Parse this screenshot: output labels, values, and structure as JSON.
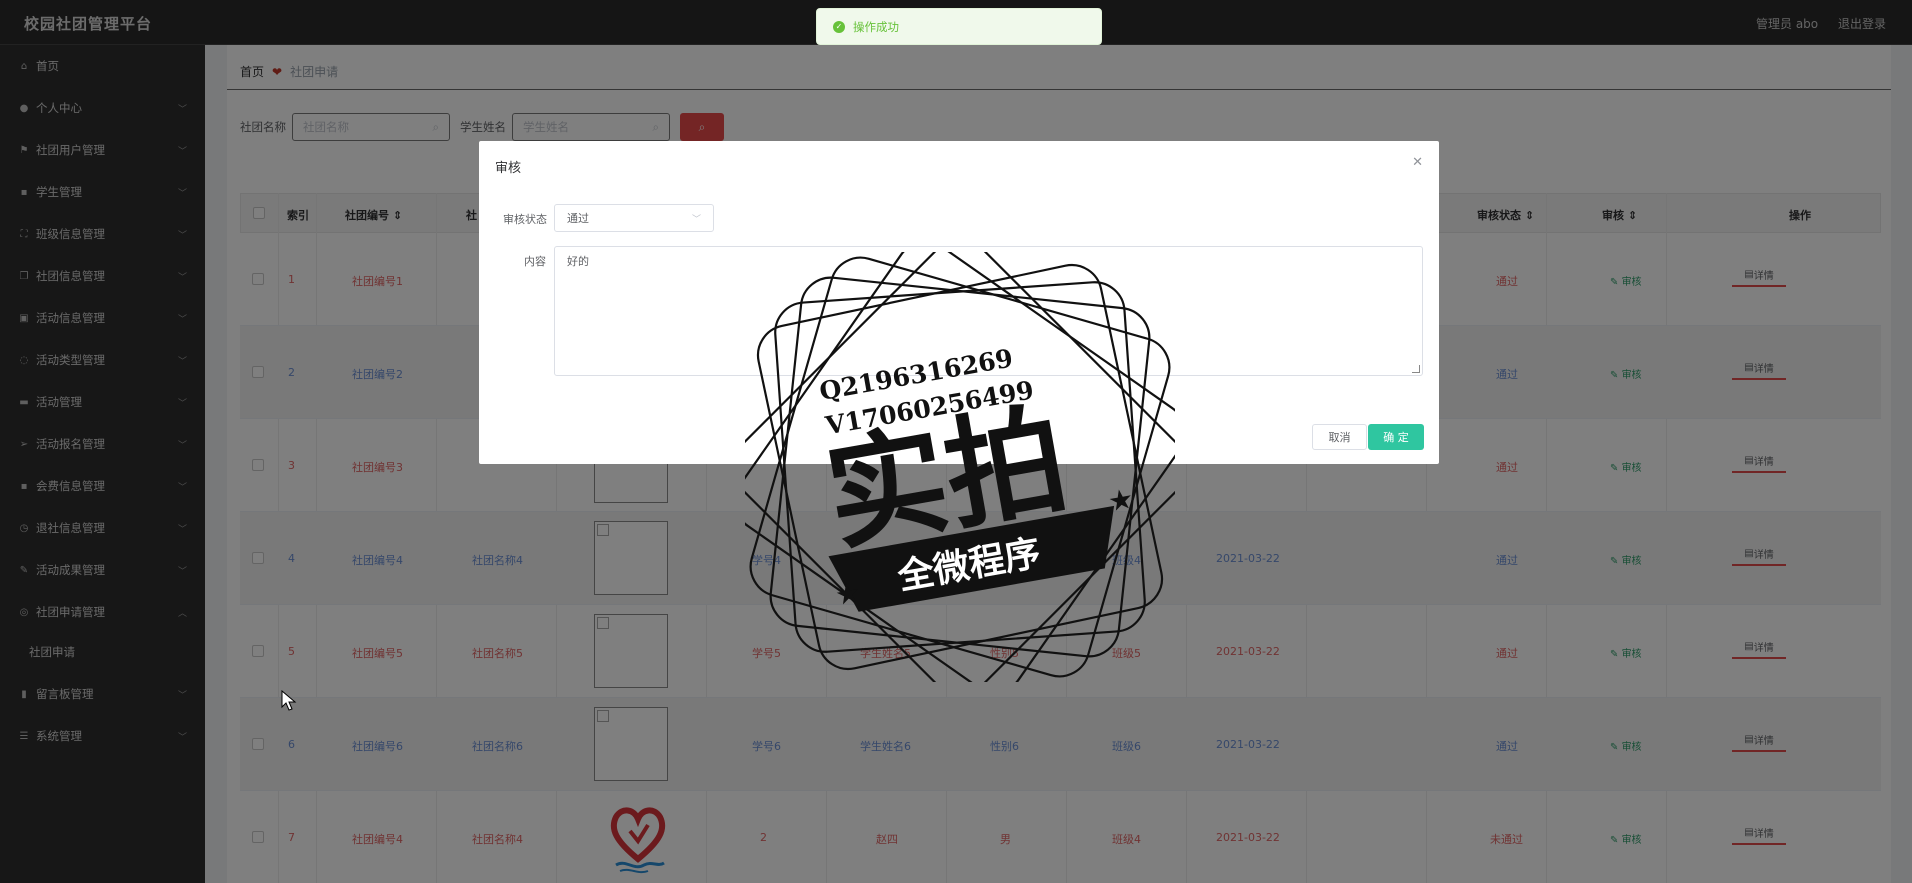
{
  "header": {
    "title": "校园社团管理平台",
    "user": "管理员 abo",
    "logout": "退出登录"
  },
  "sidebar": {
    "items": [
      {
        "label": "首页",
        "icon": "home-icon"
      },
      {
        "label": "个人中心",
        "icon": "user-icon"
      },
      {
        "label": "社团用户管理",
        "icon": "flag-icon"
      },
      {
        "label": "学生管理",
        "icon": "chat-icon"
      },
      {
        "label": "班级信息管理",
        "icon": "frame-icon"
      },
      {
        "label": "社团信息管理",
        "icon": "copy-icon"
      },
      {
        "label": "活动信息管理",
        "icon": "clipboard-icon"
      },
      {
        "label": "活动类型管理",
        "icon": "dashed-circle-icon"
      },
      {
        "label": "活动管理",
        "icon": "suitcase-icon"
      },
      {
        "label": "活动报名管理",
        "icon": "send-icon"
      },
      {
        "label": "会费信息管理",
        "icon": "chat-icon"
      },
      {
        "label": "退社信息管理",
        "icon": "clock-icon"
      },
      {
        "label": "活动成果管理",
        "icon": "edit-icon"
      },
      {
        "label": "社团申请管理",
        "icon": "circle-icon"
      },
      {
        "label": "留言板管理",
        "icon": "chart-icon"
      },
      {
        "label": "系统管理",
        "icon": "list-icon"
      }
    ],
    "submenu": "社团申请"
  },
  "breadcrumb": {
    "home": "首页",
    "current": "社团申请"
  },
  "search": {
    "club_label": "社团名称",
    "club_placeholder": "社团名称",
    "student_label": "学生姓名",
    "student_placeholder": "学生姓名"
  },
  "table": {
    "headers": {
      "index": "索引",
      "club_no": "社团编号",
      "club_name": "社",
      "audit_status": "审核状态",
      "audit": "审核",
      "ops": "操作"
    },
    "rows": [
      {
        "idx": "1",
        "no": "社团编号1",
        "color": "#e06666",
        "status": "通过"
      },
      {
        "idx": "2",
        "no": "社团编号2",
        "color": "#6b8fd4",
        "status": "通过"
      },
      {
        "idx": "3",
        "no": "社团编号3",
        "color": "#e06666",
        "status": "通过"
      },
      {
        "idx": "4",
        "no": "社团编号4",
        "name": "社团名称4",
        "sno": "学号4",
        "sname": "学",
        "sex": "",
        "cls": "班级4",
        "date": "2021-03-22",
        "color": "#6b8fd4",
        "status": "通过"
      },
      {
        "idx": "5",
        "no": "社团编号5",
        "name": "社团名称5",
        "sno": "学号5",
        "sname": "学生姓名5",
        "sex": "性别5",
        "cls": "班级5",
        "date": "2021-03-22",
        "color": "#e06666",
        "status": "通过"
      },
      {
        "idx": "6",
        "no": "社团编号6",
        "name": "社团名称6",
        "sno": "学号6",
        "sname": "学生姓名6",
        "sex": "性别6",
        "cls": "班级6",
        "date": "2021-03-22",
        "color": "#6b8fd4",
        "status": "通过"
      },
      {
        "idx": "7",
        "no": "社团编号4",
        "name": "社团名称4",
        "sno": "2",
        "sname": "赵四",
        "sex": "男",
        "cls": "班级4",
        "date": "2021-03-22",
        "color": "#e06666",
        "status": "未通过"
      }
    ],
    "audit_label": "审核",
    "detail_label": "详情"
  },
  "toast": {
    "message": "操作成功"
  },
  "dialog": {
    "title": "审核",
    "status_label": "审核状态",
    "status_value": "通过",
    "content_label": "内容",
    "content_value": "好的",
    "cancel": "取消",
    "confirm": "确 定"
  },
  "watermark": {
    "line1": "Q2196316269",
    "line2": "V17060256499",
    "big": "实拍",
    "banner": "全微程序"
  }
}
